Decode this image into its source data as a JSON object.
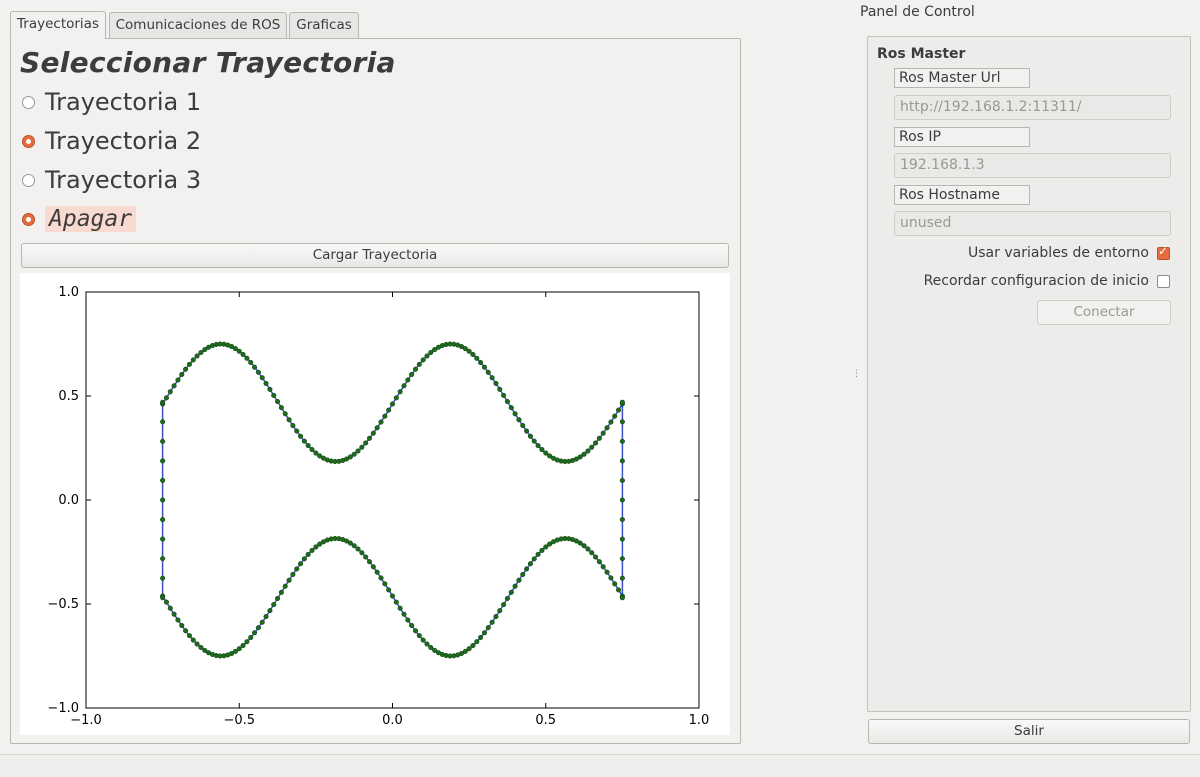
{
  "tabs": [
    "Trayectorias",
    "Comunicaciones de ROS",
    "Graficas"
  ],
  "trajectory": {
    "title": "Seleccionar Trayectoria",
    "options": [
      {
        "label": "Trayectoria 1",
        "checked": false
      },
      {
        "label": "Trayectoria 2",
        "checked": true
      },
      {
        "label": "Trayectoria 3",
        "checked": false
      },
      {
        "label": "Apagar",
        "checked": true
      }
    ],
    "load_button": "Cargar Trayectoria"
  },
  "chart_data": {
    "type": "line",
    "xlim": [
      -1.0,
      1.0
    ],
    "ylim": [
      -1.0,
      1.0
    ],
    "xticks": [
      "−1.0",
      "−0.5",
      "0.0",
      "0.5",
      "1.0"
    ],
    "yticks": [
      "1.0",
      "0.5",
      "0.0",
      "−0.5",
      "−1.0"
    ],
    "series": [
      {
        "kind": "closed path with markers",
        "line_color": "#3b4fc4",
        "marker_color": "#1e6b1e",
        "x_range": [
          -0.75,
          0.75
        ],
        "upper_wave_y_range": [
          0.185,
          0.75
        ],
        "lower_wave_y_range": [
          -0.75,
          -0.185
        ],
        "side_edge_y_range": [
          -0.47,
          0.47
        ]
      }
    ]
  },
  "control_panel": {
    "title": "Panel de Control",
    "group_title": "Ros Master",
    "master_url_label": "Ros Master Url",
    "master_url_value": "http://192.168.1.2:11311/",
    "ros_ip_label": "Ros IP",
    "ros_ip_value": "192.168.1.3",
    "hostname_label": "Ros Hostname",
    "hostname_value": "unused",
    "use_env_label": "Usar variables de entorno",
    "use_env_checked": true,
    "remember_label": "Recordar configuracion de inicio",
    "remember_checked": false,
    "connect_button": "Conectar",
    "exit_button": "Salir"
  }
}
